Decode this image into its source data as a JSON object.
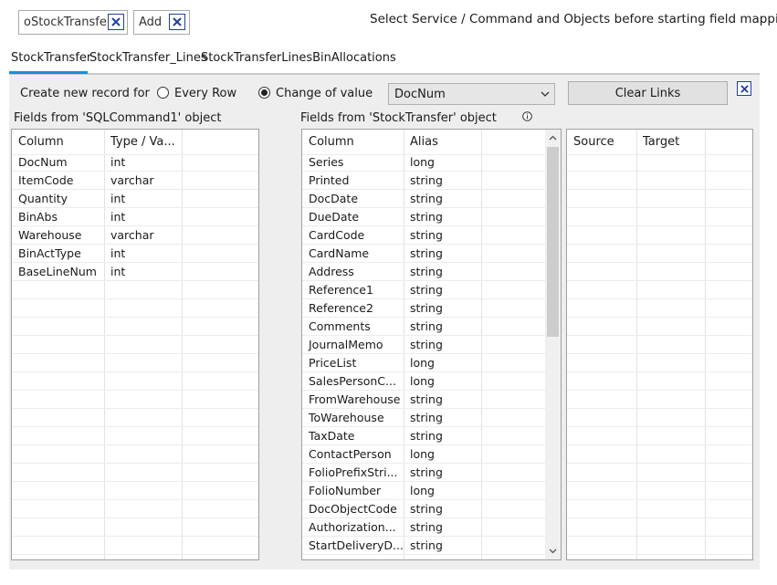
{
  "toolbar": {
    "object_chip": "oStockTransfer",
    "action_chip": "Add",
    "hint": "Select Service / Command and Objects before starting field mapping"
  },
  "tabs": [
    {
      "label": "StockTransfer",
      "active": true
    },
    {
      "label": "StockTransfer_Lines",
      "active": false
    },
    {
      "label": "StockTransferLinesBinAllocations",
      "active": false
    }
  ],
  "options": {
    "create_label": "Create new record for",
    "every_row": "Every Row",
    "change_of_value": "Change of value",
    "selected_mode": "change_of_value",
    "value_field": "DocNum",
    "clear_links": "Clear Links"
  },
  "source_panel": {
    "title": "Fields from 'SQLCommand1' object",
    "headers": [
      "Column",
      "Type / Va..."
    ],
    "rows": [
      [
        "DocNum",
        "int"
      ],
      [
        "ItemCode",
        "varchar"
      ],
      [
        "Quantity",
        "int"
      ],
      [
        "BinAbs",
        "int"
      ],
      [
        "Warehouse",
        "varchar"
      ],
      [
        "BinActType",
        "int"
      ],
      [
        "BaseLineNum",
        "int"
      ]
    ]
  },
  "target_panel": {
    "title": "Fields from 'StockTransfer' object",
    "headers": [
      "Column",
      "Alias"
    ],
    "rows": [
      [
        "Series",
        "long"
      ],
      [
        "Printed",
        "string"
      ],
      [
        "DocDate",
        "string"
      ],
      [
        "DueDate",
        "string"
      ],
      [
        "CardCode",
        "string"
      ],
      [
        "CardName",
        "string"
      ],
      [
        "Address",
        "string"
      ],
      [
        "Reference1",
        "string"
      ],
      [
        "Reference2",
        "string"
      ],
      [
        "Comments",
        "string"
      ],
      [
        "JournalMemo",
        "string"
      ],
      [
        "PriceList",
        "long"
      ],
      [
        "SalesPersonC...",
        "long"
      ],
      [
        "FromWarehouse",
        "string"
      ],
      [
        "ToWarehouse",
        "string"
      ],
      [
        "TaxDate",
        "string"
      ],
      [
        "ContactPerson",
        "long"
      ],
      [
        "FolioPrefixStri...",
        "string"
      ],
      [
        "FolioNumber",
        "long"
      ],
      [
        "DocObjectCode",
        "string"
      ],
      [
        "Authorization...",
        "string"
      ],
      [
        "StartDeliveryD...",
        "string"
      ]
    ]
  },
  "links_panel": {
    "headers": [
      "Source",
      "Target"
    ]
  }
}
